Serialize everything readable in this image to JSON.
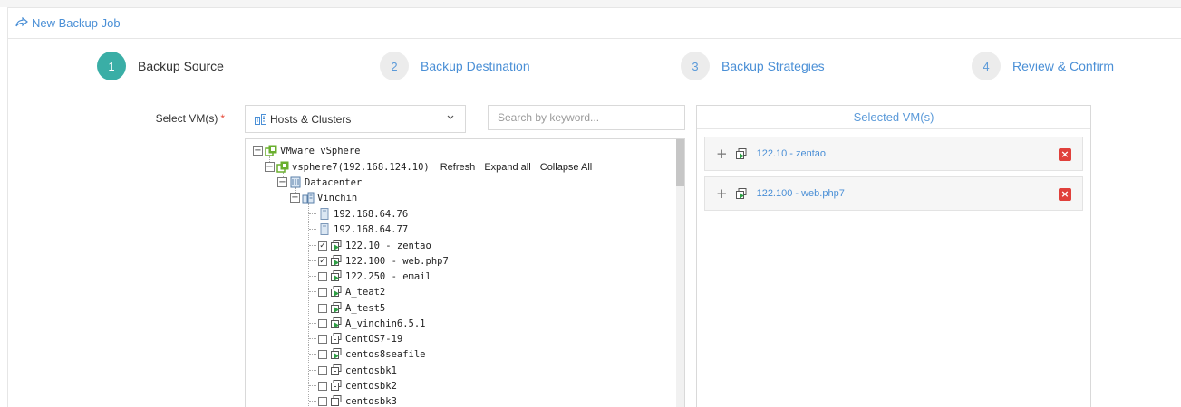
{
  "header": {
    "title": "New Backup Job",
    "icon": "share-icon"
  },
  "steps": [
    {
      "number": "1",
      "label": "Backup Source",
      "state": "active"
    },
    {
      "number": "2",
      "label": "Backup Destination",
      "state": "inactive"
    },
    {
      "number": "3",
      "label": "Backup Strategies",
      "state": "inactive"
    },
    {
      "number": "4",
      "label": "Review & Confirm",
      "state": "inactive"
    }
  ],
  "form": {
    "label": "Select VM(s)",
    "required_mark": "*",
    "view_select": {
      "value": "Hosts & Clusters",
      "icon": "hosts-clusters-icon"
    },
    "search": {
      "placeholder": "Search by keyword..."
    }
  },
  "tree": {
    "root": "VMware vSphere",
    "host": "vsphere7(192.168.124.10)",
    "host_actions": [
      "Refresh",
      "Expand all",
      "Collapse All"
    ],
    "datacenter": "Datacenter",
    "cluster": "Vinchin",
    "items": [
      {
        "label": "192.168.64.76",
        "type": "host",
        "checked": null
      },
      {
        "label": "192.168.64.77",
        "type": "host",
        "checked": null
      },
      {
        "label": "122.10 - zentao",
        "type": "vm-on",
        "checked": true
      },
      {
        "label": "122.100 - web.php7",
        "type": "vm-on",
        "checked": true
      },
      {
        "label": "122.250 - email",
        "type": "vm-on",
        "checked": false
      },
      {
        "label": "A_teat2",
        "type": "vm-on",
        "checked": false
      },
      {
        "label": "A_test5",
        "type": "vm-on",
        "checked": false
      },
      {
        "label": "A_vinchin6.5.1",
        "type": "vm-on",
        "checked": false
      },
      {
        "label": "CentOS7-19",
        "type": "vm-off",
        "checked": false
      },
      {
        "label": "centos8seafile",
        "type": "vm-on",
        "checked": false
      },
      {
        "label": "centosbk1",
        "type": "vm-off",
        "checked": false
      },
      {
        "label": "centosbk2",
        "type": "vm-off",
        "checked": false
      },
      {
        "label": "centosbk3",
        "type": "vm-off",
        "checked": false
      }
    ]
  },
  "selected": {
    "title": "Selected VM(s)",
    "items": [
      {
        "name": "122.10 - zentao"
      },
      {
        "name": "122.100 - web.php7"
      }
    ]
  },
  "colors": {
    "accent": "#3aaea6",
    "link": "#4a8fd6",
    "remove": "#e0403b",
    "vm_green": "#2e9e44",
    "vsphere_green": "#6aaf2e"
  }
}
